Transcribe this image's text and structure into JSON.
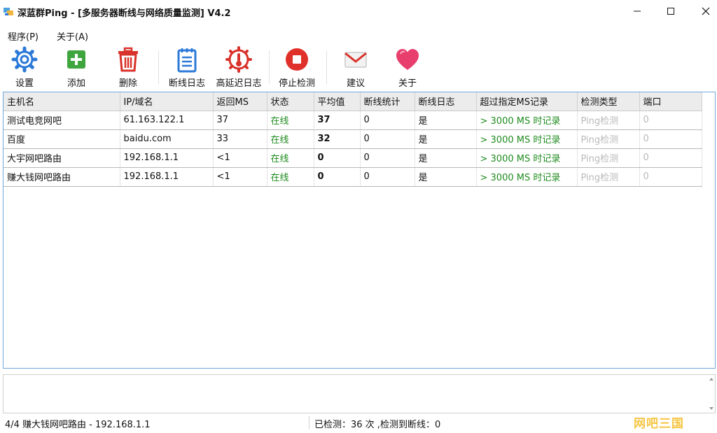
{
  "window": {
    "title": "深蓝群Ping - [多服务器断线与网络质量监测] V4.2",
    "controls": {
      "minimize": "—",
      "maximize": "☐",
      "close": "✕"
    }
  },
  "menu": {
    "items": [
      {
        "label": "程序(P)"
      },
      {
        "label": "关于(A)"
      }
    ]
  },
  "toolbar": {
    "settings": "设置",
    "add": "添加",
    "delete": "删除",
    "disconnect_log": "断线日志",
    "latency_log": "高延迟日志",
    "stop": "停止检测",
    "suggest": "建议",
    "about": "关于"
  },
  "table": {
    "headers": [
      "主机名",
      "IP/域名",
      "返回MS",
      "状态",
      "平均值",
      "断线统计",
      "断线日志",
      "超过指定MS记录",
      "检测类型",
      "端口"
    ],
    "rows": [
      {
        "host": "测试电竞网吧",
        "ip": "61.163.122.1",
        "ms": "37",
        "status": "在线",
        "avg": "37",
        "drops": "0",
        "droplog": "是",
        "threshold": "> 3000 MS 时记录",
        "type": "Ping检测",
        "port": "0"
      },
      {
        "host": "百度",
        "ip": "baidu.com",
        "ms": "33",
        "status": "在线",
        "avg": "32",
        "drops": "0",
        "droplog": "是",
        "threshold": "> 3000 MS 时记录",
        "type": "Ping检测",
        "port": "0"
      },
      {
        "host": "大宇网吧路由",
        "ip": "192.168.1.1",
        "ms": "<1",
        "status": "在线",
        "avg": "0",
        "drops": "0",
        "droplog": "是",
        "threshold": "> 3000 MS 时记录",
        "type": "Ping检测",
        "port": "0"
      },
      {
        "host": "赚大钱网吧路由",
        "ip": "192.168.1.1",
        "ms": "<1",
        "status": "在线",
        "avg": "0",
        "drops": "0",
        "droplog": "是",
        "threshold": "> 3000 MS 时记录",
        "type": "Ping检测",
        "port": "0"
      }
    ]
  },
  "status": {
    "left": "4/4 赚大钱网吧路由 - 192.168.1.1",
    "right": "已检测：36 次 ,检测到断线：0"
  },
  "watermark": "网吧三国",
  "colors": {
    "online": "#1e8b1e",
    "accent_blue": "#2b79d8",
    "add_green": "#3fa63f",
    "delete_red": "#d9322b",
    "frame_blue": "#6fa8dc",
    "disabled_gray": "#b9b9b9"
  },
  "icons": {
    "settings": "gear-icon",
    "add": "plus-icon",
    "delete": "trash-icon",
    "disconnect_log": "notepad-icon",
    "latency_log": "thermometer-gear-icon",
    "stop": "stop-circle-icon",
    "suggest": "envelope-icon",
    "about": "heart-icon"
  }
}
